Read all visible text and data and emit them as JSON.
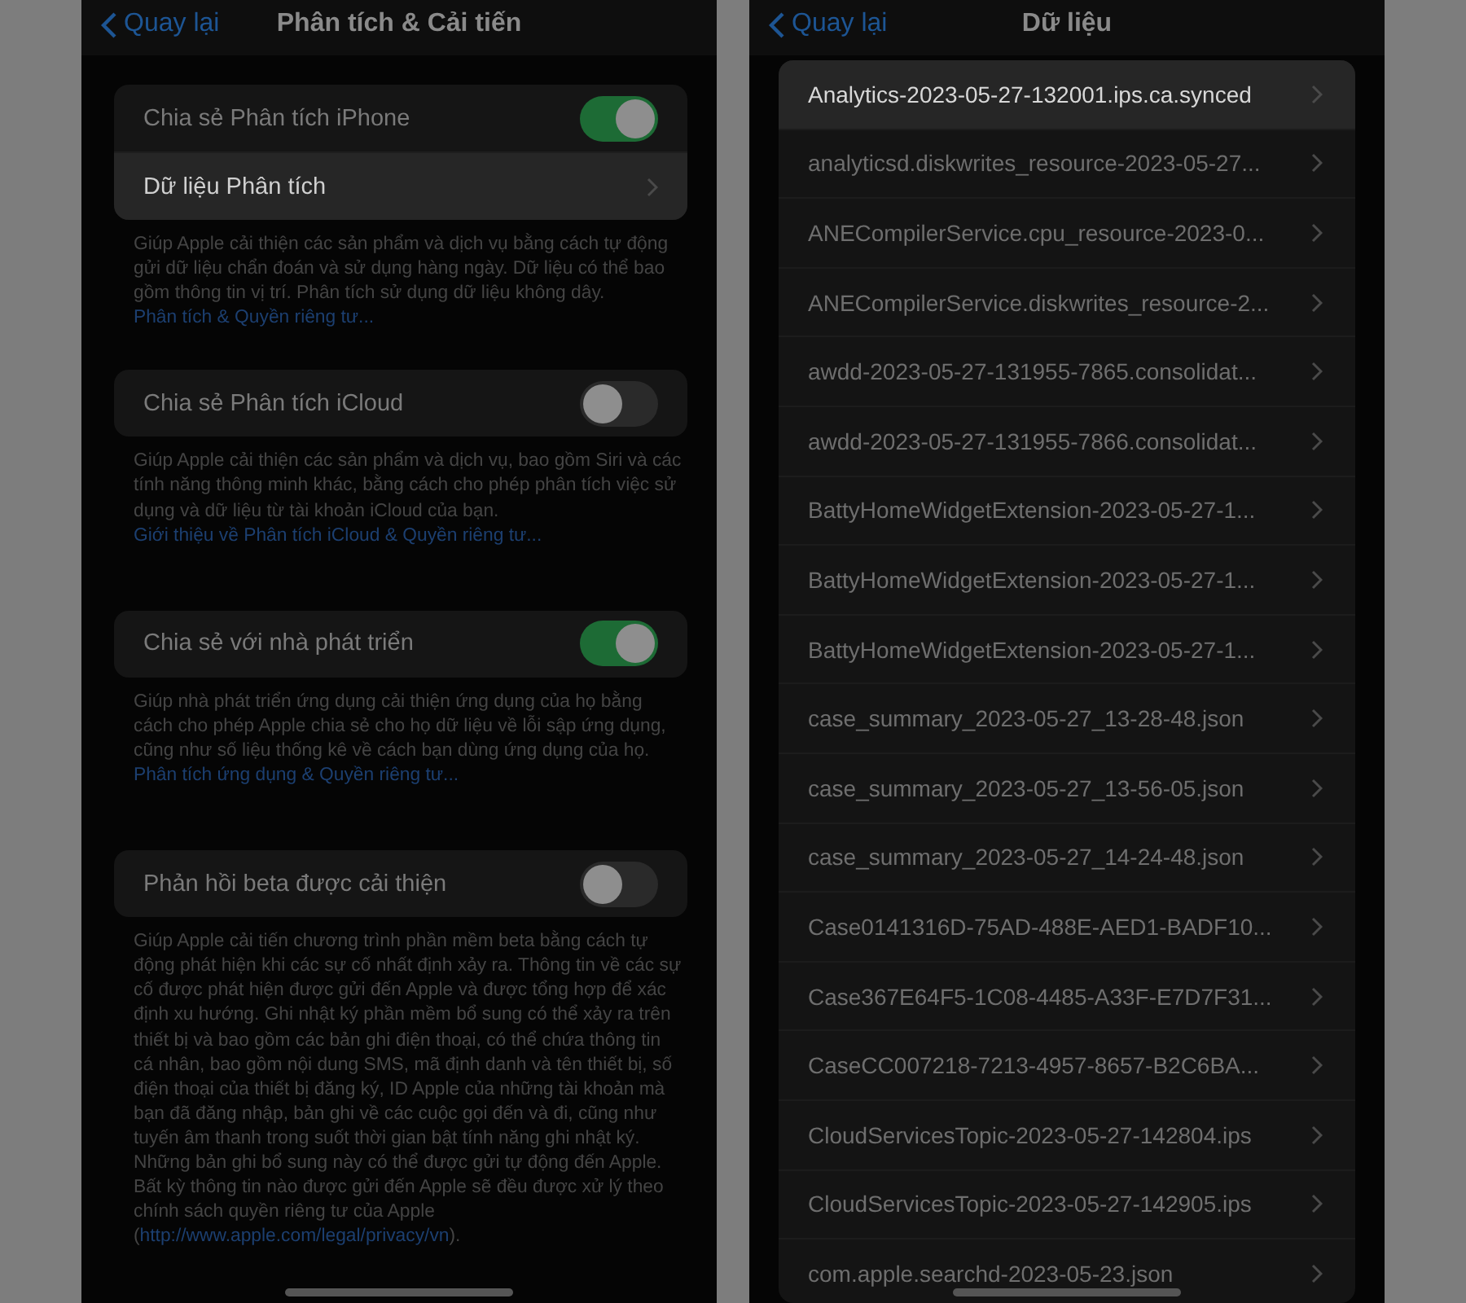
{
  "settings_screen": {
    "back_label": "Quay lại",
    "title": "Phân tích & Cải tiến",
    "sections": [
      {
        "rows": [
          {
            "kind": "toggle",
            "label": "Chia sẻ Phân tích iPhone",
            "on": true,
            "highlighted": false
          },
          {
            "kind": "link",
            "label": "Dữ liệu Phân tích",
            "highlighted": true
          }
        ],
        "footer": {
          "text": "Giúp Apple cải thiện các sản phẩm và dịch vụ bằng cách tự động gửi dữ liệu chẩn đoán và sử dụng hàng ngày. Dữ liệu có thể bao gồm thông tin vị trí. Phân tích sử dụng dữ liệu không dây.",
          "link": "Phân tích & Quyền riêng tư..."
        }
      },
      {
        "rows": [
          {
            "kind": "toggle",
            "label": "Chia sẻ Phân tích iCloud",
            "on": false,
            "highlighted": false
          }
        ],
        "footer": {
          "text": "Giúp Apple cải thiện các sản phẩm và dịch vụ, bao gồm Siri và các tính năng thông minh khác, bằng cách cho phép phân tích việc sử dụng và dữ liệu từ tài khoản iCloud của bạn.",
          "link": "Giới thiệu về Phân tích iCloud & Quyền riêng tư..."
        }
      },
      {
        "rows": [
          {
            "kind": "toggle",
            "label": "Chia sẻ với nhà phát triển",
            "on": true,
            "highlighted": false
          }
        ],
        "footer": {
          "text": "Giúp nhà phát triển ứng dụng cải thiện ứng dụng của họ bằng cách cho phép Apple chia sẻ cho họ dữ liệu về lỗi sập ứng dụng, cũng như số liệu thống kê về cách bạn dùng ứng dụng của họ.",
          "link": "Phân tích ứng dụng & Quyền riêng tư..."
        }
      },
      {
        "rows": [
          {
            "kind": "toggle",
            "label": "Phản hồi beta được cải thiện",
            "on": false,
            "highlighted": false
          }
        ],
        "footer": {
          "text": "Giúp Apple cải tiến chương trình phần mềm beta bằng cách tự động phát hiện khi các sự cố nhất định xảy ra. Thông tin về các sự cố được phát hiện được gửi đến Apple và được tổng hợp để xác định xu hướng. Ghi nhật ký phần mềm bổ sung có thể xảy ra trên thiết bị và bao gồm các bản ghi điện thoại, có thể chứa thông tin cá nhân, bao gồm nội dung SMS, mã định danh và tên thiết bị, số điện thoại của thiết bị đăng ký, ID Apple của những tài khoản mà bạn đã đăng nhập, bản ghi về các cuộc gọi đến và đi, cũng như tuyến âm thanh trong suốt thời gian bật tính năng ghi nhật ký. Những bản ghi bổ sung này có thể được gửi tự động đến Apple. Bất kỳ thông tin nào được gửi đến Apple sẽ đều được xử lý theo chính sách quyền riêng tư của Apple (",
          "link": "http://www.apple.com/legal/privacy/vn",
          "tail": ")."
        }
      }
    ]
  },
  "data_screen": {
    "back_label": "Quay lại",
    "title": "Dữ liệu",
    "files": [
      {
        "name": "Analytics-2023-05-27-132001.ips.ca.synced",
        "highlighted": true
      },
      {
        "name": "analyticsd.diskwrites_resource-2023-05-27...",
        "highlighted": false
      },
      {
        "name": "ANECompilerService.cpu_resource-2023-0...",
        "highlighted": false
      },
      {
        "name": "ANECompilerService.diskwrites_resource-2...",
        "highlighted": false
      },
      {
        "name": "awdd-2023-05-27-131955-7865.consolidat...",
        "highlighted": false
      },
      {
        "name": "awdd-2023-05-27-131955-7866.consolidat...",
        "highlighted": false
      },
      {
        "name": "BattyHomeWidgetExtension-2023-05-27-1...",
        "highlighted": false
      },
      {
        "name": "BattyHomeWidgetExtension-2023-05-27-1...",
        "highlighted": false
      },
      {
        "name": "BattyHomeWidgetExtension-2023-05-27-1...",
        "highlighted": false
      },
      {
        "name": "case_summary_2023-05-27_13-28-48.json",
        "highlighted": false
      },
      {
        "name": "case_summary_2023-05-27_13-56-05.json",
        "highlighted": false
      },
      {
        "name": "case_summary_2023-05-27_14-24-48.json",
        "highlighted": false
      },
      {
        "name": "Case0141316D-75AD-488E-AED1-BADF10...",
        "highlighted": false
      },
      {
        "name": "Case367E64F5-1C08-4485-A33F-E7D7F31...",
        "highlighted": false
      },
      {
        "name": "CaseCC007218-7213-4957-8657-B2C6BA...",
        "highlighted": false
      },
      {
        "name": "CloudServicesTopic-2023-05-27-142804.ips",
        "highlighted": false
      },
      {
        "name": "CloudServicesTopic-2023-05-27-142905.ips",
        "highlighted": false
      },
      {
        "name": "com.apple.searchd-2023-05-23.json",
        "highlighted": false
      }
    ]
  }
}
